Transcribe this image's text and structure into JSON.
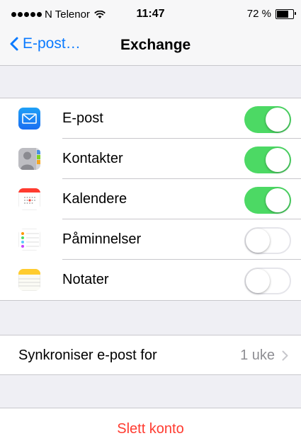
{
  "status_bar": {
    "carrier": "N Telenor",
    "time": "11:47",
    "battery": "72 %",
    "battery_level": 0.72
  },
  "nav": {
    "back_label": "E-post…",
    "title": "Exchange"
  },
  "services": [
    {
      "label": "E-post",
      "icon": "mail-icon",
      "on": true
    },
    {
      "label": "Kontakter",
      "icon": "contacts-icon",
      "on": true
    },
    {
      "label": "Kalendere",
      "icon": "calendar-icon",
      "on": true
    },
    {
      "label": "Påminnelser",
      "icon": "reminders-icon",
      "on": false
    },
    {
      "label": "Notater",
      "icon": "notes-icon",
      "on": false
    }
  ],
  "sync": {
    "label": "Synkroniser e-post for",
    "value": "1 uke"
  },
  "delete_label": "Slett konto",
  "colors": {
    "accent": "#0a7aff",
    "toggle_on": "#4cd964",
    "destructive": "#ff3b30"
  }
}
